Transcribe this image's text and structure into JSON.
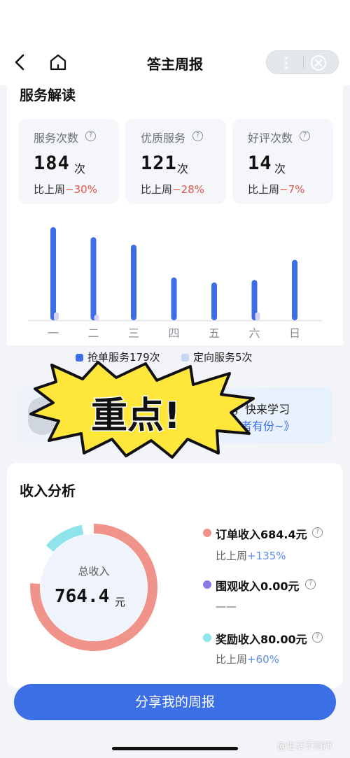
{
  "header": {
    "title": "答主周报"
  },
  "service": {
    "section_title": "服务解读",
    "stats": [
      {
        "label": "服务次数",
        "value": "184",
        "unit": "次",
        "change_prefix": "比上周",
        "change": "−30%"
      },
      {
        "label": "优质服务",
        "value": "121",
        "unit": "次",
        "change_prefix": "比上周",
        "change": "−28%"
      },
      {
        "label": "好评次数",
        "value": "14",
        "unit": "次",
        "change_prefix": "比上周",
        "change": "−7%"
      }
    ],
    "legend": [
      {
        "label": "抢单服务179次",
        "color": "#3d6ee6"
      },
      {
        "label": "定向服务5次",
        "color": "#c9d6f5"
      }
    ]
  },
  "chart_data": {
    "type": "bar",
    "categories": [
      "一",
      "二",
      "三",
      "四",
      "五",
      "六",
      "日"
    ],
    "series": [
      {
        "name": "抢单服务179次",
        "color": "#3d6ee6",
        "values": [
          37,
          33,
          30,
          17,
          15,
          16,
          24
        ]
      },
      {
        "name": "定向服务5次",
        "color": "#d9d3f2",
        "values": [
          2,
          1,
          0,
          0,
          0,
          2,
          0
        ]
      }
    ],
    "ylim": [
      0,
      40
    ]
  },
  "banner": {
    "line1": "，快来学习",
    "line2": "者有份~》",
    "sticker_text": "重点!"
  },
  "income": {
    "section_title": "收入分析",
    "total_label": "总收入",
    "total_value": "764.4",
    "total_unit": "元",
    "items": [
      {
        "name": "订单收入684.4元",
        "value": 684.4,
        "color": "#f0938a",
        "change_prefix": "比上周",
        "change": "+135%"
      },
      {
        "name": "围观收入0.00元",
        "value": 0,
        "color": "#8c7ae6",
        "change_prefix": "",
        "change": "——"
      },
      {
        "name": "奖励收入80.00元",
        "value": 80.0,
        "color": "#8fe3ea",
        "change_prefix": "比上周",
        "change": "+60%"
      }
    ]
  },
  "share_button": "分享我的周报",
  "watermark": "@生活不刻神"
}
